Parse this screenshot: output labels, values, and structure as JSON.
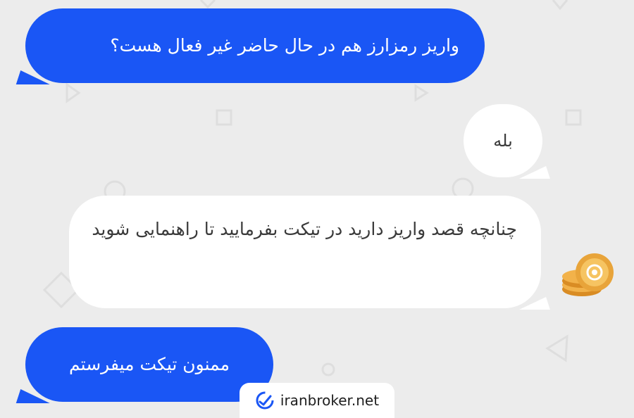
{
  "chat": {
    "messages": [
      {
        "from": "user",
        "text": "واریز رمزارز هم در حال حاضر غیر فعال هست؟"
      },
      {
        "from": "support",
        "text": "بله"
      },
      {
        "from": "support",
        "text": "چنانچه قصد واریز دارید در تیکت بفرمایید تا راهنمایی شوید"
      },
      {
        "from": "user",
        "text": "ممنون تیکت میفرستم"
      }
    ]
  },
  "watermark": {
    "site": "iranbroker.net",
    "icon": "chart-check-icon"
  },
  "colors": {
    "user_bubble": "#1a56f5",
    "support_bubble": "#ffffff",
    "background": "#ececec",
    "coin": "#e8a43a"
  }
}
